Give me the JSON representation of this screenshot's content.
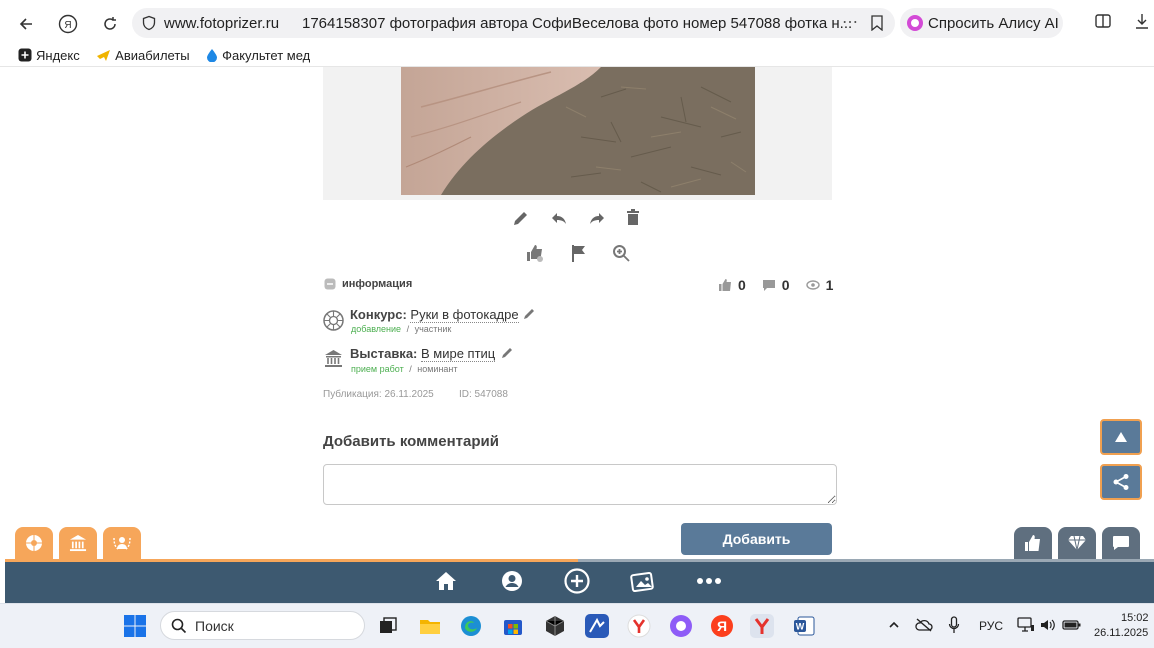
{
  "browser": {
    "url_domain": "www.fotoprizer.ru",
    "url_title": "1764158307 фотография автора СофиВеселова фото номер 547088 фотка н...",
    "alice_label": "Спросить Алису AI",
    "bookmarks": [
      {
        "label": "Яндекс",
        "icon": "plus-square-icon"
      },
      {
        "label": "Авиабилеты",
        "icon": "plane-icon"
      },
      {
        "label": "Факультет медиа",
        "icon": "drop-icon"
      }
    ]
  },
  "photo": {
    "actions": [
      "edit-icon",
      "reply-icon",
      "forward-icon",
      "trash-icon"
    ],
    "actions2": [
      "like-icon",
      "flag-icon",
      "zoom-icon"
    ]
  },
  "info": {
    "section_label": "информация",
    "likes": "0",
    "comments": "0",
    "views": "1",
    "contest": {
      "label": "Конкурс:",
      "name": "Руки в фотокадре",
      "status": "добавление",
      "separator": "/",
      "role": "участник"
    },
    "exhibition": {
      "label": "Выставка:",
      "name": "В мире птиц",
      "status": "прием работ",
      "separator": "/",
      "role": "номинант"
    },
    "published": "Публикация: 26.11.2025",
    "id": "ID: 547088"
  },
  "comment": {
    "title": "Добавить комментарий",
    "placeholder": "",
    "submit_label": "Добавить"
  },
  "taskbar": {
    "search_label": "Поиск",
    "lang": "РУС",
    "time": "15:02",
    "date": "26.11.2025"
  },
  "colors": {
    "accent_orange": "#f6a65a",
    "nav_blue": "#3d5970",
    "button_blue": "#5a7a99"
  }
}
